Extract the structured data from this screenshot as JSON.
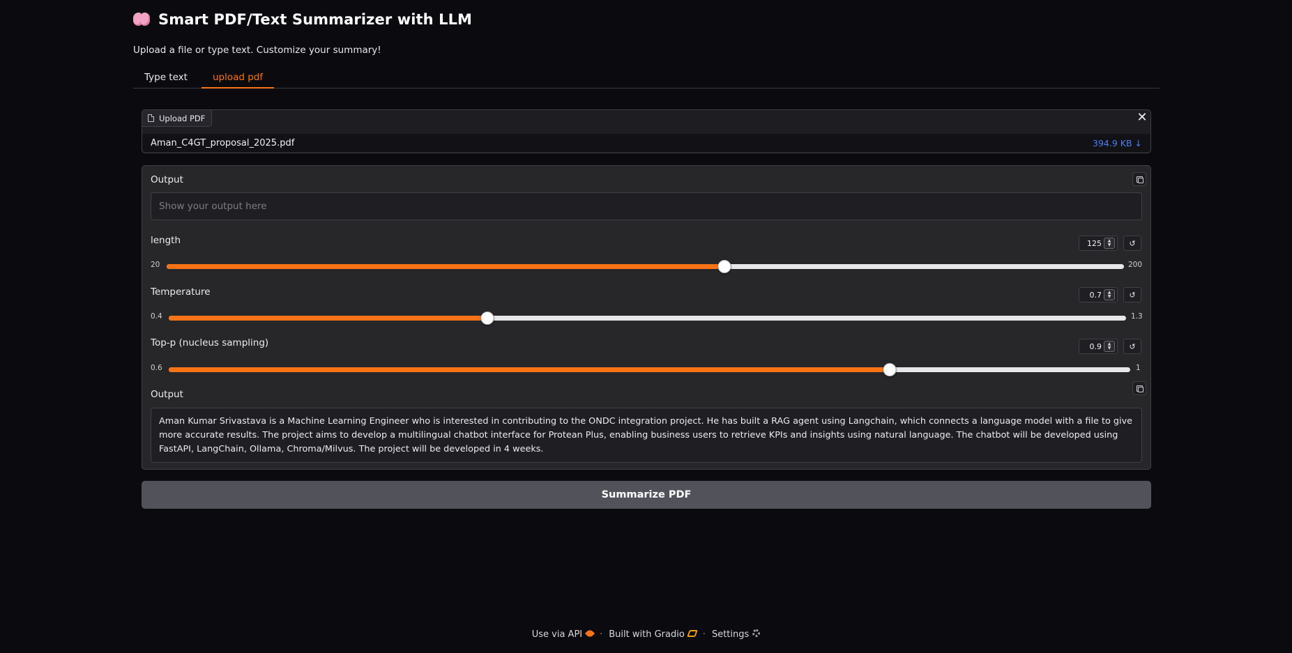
{
  "header": {
    "title": "Smart PDF/Text Summarizer with LLM",
    "subtitle": "Upload a file or type text. Customize your summary!"
  },
  "tabs": [
    {
      "label": "Type text",
      "active": false
    },
    {
      "label": "upload pdf",
      "active": true
    }
  ],
  "upload": {
    "label": "Upload PDF",
    "file_name": "Aman_C4GT_proposal_2025.pdf",
    "file_size": "394.9 KB ↓",
    "close_glyph": "✕"
  },
  "output_top": {
    "label": "Output",
    "placeholder": "Show your output here",
    "value": ""
  },
  "sliders": [
    {
      "label": "length",
      "value": "125",
      "min": "20",
      "max": "200",
      "fraction": 0.583
    },
    {
      "label": "Temperature",
      "value": "0.7",
      "min": "0.4",
      "max": "1.3",
      "fraction": 0.333
    },
    {
      "label": "Top-p (nucleus sampling)",
      "value": "0.9",
      "min": "0.6",
      "max": "1",
      "fraction": 0.75
    }
  ],
  "output_bottom": {
    "label": "Output",
    "text": "Aman Kumar Srivastava is a Machine Learning Engineer who is interested in contributing to the ONDC integration project. He has built a RAG agent using Langchain, which connects a language model with a file to give more accurate results. The project aims to develop a multilingual chatbot interface for Protean Plus, enabling business users to retrieve KPIs and insights using natural language. The chatbot will be developed using FastAPI, LangChain, Ollama, Chroma/Milvus. The project will be developed in 4 weeks."
  },
  "submit": {
    "label": "Summarize PDF"
  },
  "footer": {
    "api": "Use via API",
    "gradio": "Built with Gradio",
    "settings": "Settings",
    "separator": "·"
  },
  "colors": {
    "accent": "#f97316",
    "background": "#0b0b0f",
    "panel": "#27272a",
    "link": "#4f7bf7",
    "button": "#52525b"
  },
  "icons": {
    "title": "brain-icon",
    "upload": "file-icon",
    "copy": "copy-icon",
    "reset": "reset-icon",
    "api": "rocket-icon",
    "gradio": "gradio-logo-icon",
    "settings": "gear-icon"
  }
}
